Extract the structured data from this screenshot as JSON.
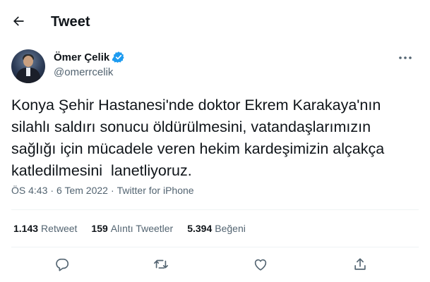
{
  "header": {
    "title": "Tweet",
    "back_icon": "arrow-left-icon"
  },
  "author": {
    "name": "Ömer Çelik",
    "handle": "@omerrcelik",
    "verified": true,
    "verified_color": "#1d9bf0"
  },
  "tweet": {
    "text": "Konya Şehir Hastanesi'nde doktor Ekrem Karakaya'nın\nsilahlı saldırı sonucu öldürülmesini, vatandaşlarımızın\nsağlığı için mücadele veren hekim kardeşimizin alçakça\nkatledilmesini  lanetliyoruz.",
    "time": "ÖS 4:43",
    "separator": "·",
    "date": "6 Tem 2022",
    "source": "Twitter for iPhone"
  },
  "stats": {
    "retweets": {
      "count": "1.143",
      "label": "Retweet"
    },
    "quotes": {
      "count": "159",
      "label": "Alıntı Tweetler"
    },
    "likes": {
      "count": "5.394",
      "label": "Beğeni"
    }
  },
  "actions": [
    "reply-icon",
    "retweet-icon",
    "like-icon",
    "share-icon"
  ],
  "colors": {
    "text": "#0f1419",
    "secondary": "#536471",
    "divider": "#eff3f4",
    "accent": "#1d9bf0"
  }
}
